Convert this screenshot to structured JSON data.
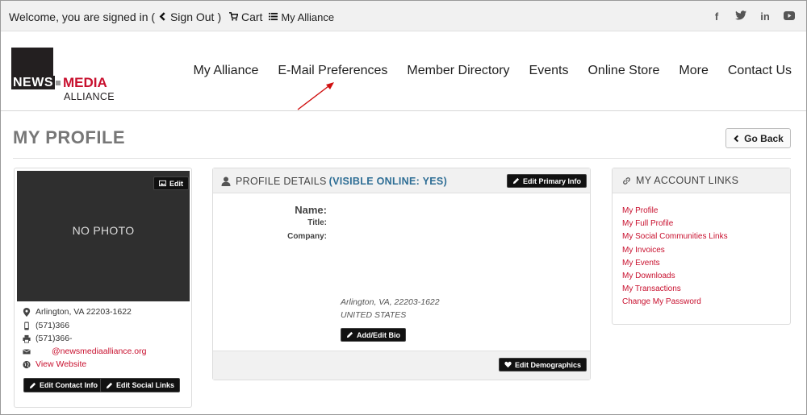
{
  "topbar": {
    "welcome": "Welcome, you are signed in (",
    "sign_out": "Sign Out",
    "close_paren": ")",
    "cart": "Cart",
    "my_alliance": "My Alliance",
    "social": [
      "f",
      "t",
      "in",
      "yt"
    ]
  },
  "logo": {
    "news": "NEWS",
    "media": "MEDIA",
    "alliance": "ALLIANCE"
  },
  "nav": [
    "My Alliance",
    "E-Mail Preferences",
    "Member Directory",
    "Events",
    "Online Store",
    "More",
    "Contact Us"
  ],
  "page": {
    "title": "MY PROFILE",
    "go_back": "Go Back"
  },
  "photo_card": {
    "no_photo": "NO PHOTO",
    "edit": "Edit",
    "location": "Arlington, VA 22203-1622",
    "phone": "(571)366",
    "fax": "(571)366-",
    "email": "@newsmediaalliance.org",
    "website": "View Website",
    "edit_contact": "Edit Contact Info",
    "edit_social": "Edit Social Links"
  },
  "details": {
    "title": "PROFILE DETAILS",
    "visible_open": "(",
    "visible": "VISIBLE ONLINE: YES",
    "visible_close": ")",
    "edit_primary": "Edit Primary Info",
    "name_label": "Name:",
    "title_label": "Title:",
    "company_label": "Company:",
    "address_line1": "Arlington, VA, 22203-1622",
    "address_line2": "UNITED STATES",
    "add_bio": "Add/Edit Bio",
    "edit_demographics": "Edit Demographics"
  },
  "account_links": {
    "title": "MY ACCOUNT LINKS",
    "items": [
      "My Profile",
      "My Full Profile",
      "My Social Communities Links",
      "My Invoices",
      "My Events",
      "My Downloads",
      "My Transactions",
      "Change My Password"
    ]
  },
  "colors": {
    "accent_red": "#c8102e",
    "visible_blue": "#2e6e95",
    "button_black": "#111111"
  }
}
